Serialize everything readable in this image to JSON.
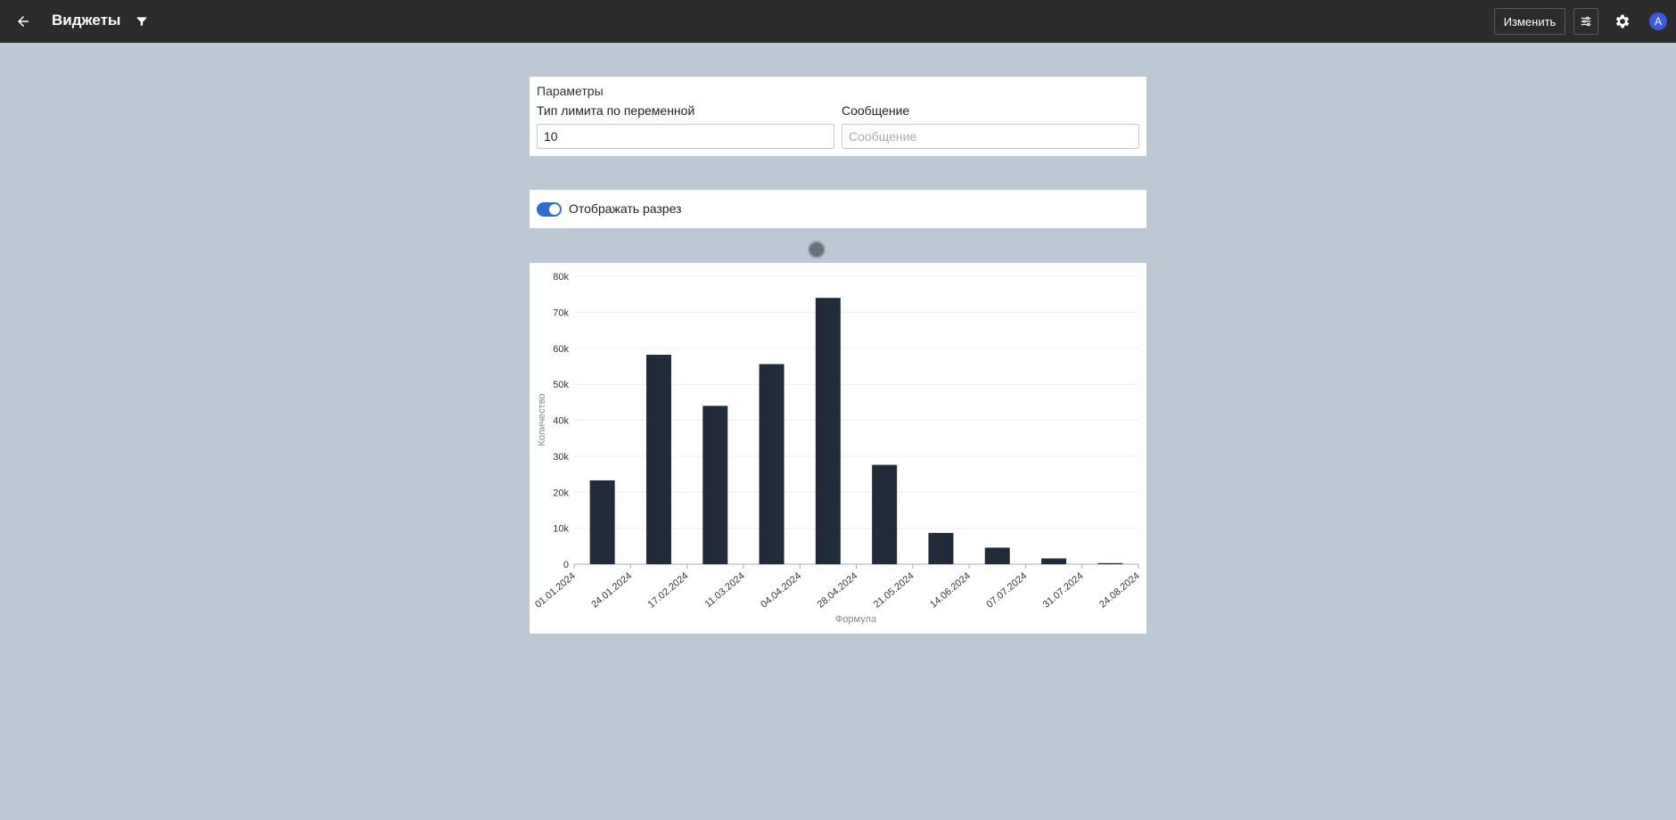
{
  "header": {
    "title": "Виджеты",
    "edit_label": "Изменить",
    "avatar_letter": "A"
  },
  "params": {
    "title": "Параметры",
    "limit_label": "Тип лимита по переменной",
    "limit_value": "10",
    "message_label": "Сообщение",
    "message_placeholder": "Сообщение"
  },
  "toggle": {
    "label": "Отображать разрез",
    "on": true
  },
  "colors": {
    "topbar": "#2b2b2b",
    "background": "#bcc9d4",
    "bar": "#222b3a",
    "accent": "#2f6cd4"
  },
  "chart_data": {
    "type": "bar",
    "x_ticks": [
      "01.01.2024",
      "24.01.2024",
      "17.02.2024",
      "11.03.2024",
      "04.04.2024",
      "28.04.2024",
      "21.05.2024",
      "14.06.2024",
      "07.07.2024",
      "31.07.2024",
      "24.08.2024"
    ],
    "y_ticks": [
      "0",
      "10k",
      "20k",
      "30k",
      "40k",
      "50k",
      "60k",
      "70k",
      "80k"
    ],
    "values": [
      23300,
      58200,
      44000,
      55600,
      74000,
      27600,
      8700,
      4600,
      1600,
      300
    ],
    "xlabel": "Формула",
    "ylabel": "Количество",
    "ylim": [
      0,
      80000
    ],
    "grid": true
  }
}
